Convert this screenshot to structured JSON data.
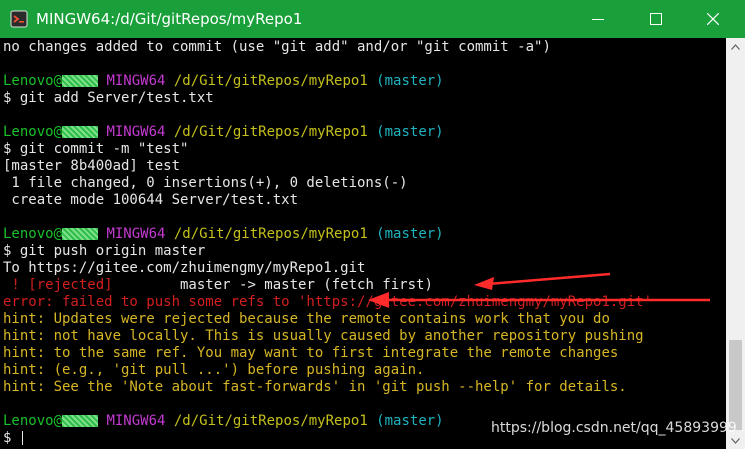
{
  "window": {
    "title": "MINGW64:/d/Git/gitRepos/myRepo1",
    "colors": {
      "titlebar": "#1aa03a",
      "background": "#000000"
    }
  },
  "terminal": {
    "lines": [
      {
        "segments": [
          {
            "text": "no changes added to commit (use \"git add\" and/or \"git commit -a\")",
            "color": "white"
          }
        ]
      },
      {
        "segments": []
      },
      {
        "segments": [
          {
            "text": "Lenovo@",
            "color": "green"
          },
          {
            "redact": true
          },
          {
            "text": " MINGW64",
            "color": "magenta"
          },
          {
            "text": " /d/Git/gitRepos/myRepo1",
            "color": "yellow"
          },
          {
            "text": " (master)",
            "color": "cyan"
          }
        ]
      },
      {
        "segments": [
          {
            "text": "$ git add Server/test.txt",
            "color": "white"
          }
        ]
      },
      {
        "segments": []
      },
      {
        "segments": [
          {
            "text": "Lenovo@",
            "color": "green"
          },
          {
            "redact": true
          },
          {
            "text": " MINGW64",
            "color": "magenta"
          },
          {
            "text": " /d/Git/gitRepos/myRepo1",
            "color": "yellow"
          },
          {
            "text": " (master)",
            "color": "cyan"
          }
        ]
      },
      {
        "segments": [
          {
            "text": "$ git commit -m \"test\"",
            "color": "white"
          }
        ]
      },
      {
        "segments": [
          {
            "text": "[master 8b400ad] test",
            "color": "white"
          }
        ]
      },
      {
        "segments": [
          {
            "text": " 1 file changed, 0 insertions(+), 0 deletions(-)",
            "color": "white"
          }
        ]
      },
      {
        "segments": [
          {
            "text": " create mode 100644 Server/test.txt",
            "color": "white"
          }
        ]
      },
      {
        "segments": []
      },
      {
        "segments": [
          {
            "text": "Lenovo@",
            "color": "green"
          },
          {
            "redact": true
          },
          {
            "text": " MINGW64",
            "color": "magenta"
          },
          {
            "text": " /d/Git/gitRepos/myRepo1",
            "color": "yellow"
          },
          {
            "text": " (master)",
            "color": "cyan"
          }
        ]
      },
      {
        "segments": [
          {
            "text": "$ git push origin master",
            "color": "white"
          }
        ]
      },
      {
        "segments": [
          {
            "text": "To https://gitee.com/zhuimengmy/myRepo1.git",
            "color": "white"
          }
        ]
      },
      {
        "segments": [
          {
            "text": " ! [rejected]",
            "color": "red"
          },
          {
            "text": "        master -> master (fetch first)",
            "color": "white"
          }
        ]
      },
      {
        "segments": [
          {
            "text": "error: failed to push some refs to 'https://gitee.com/zhuimengmy/myRepo1.git'",
            "color": "red"
          }
        ]
      },
      {
        "segments": [
          {
            "text": "hint: Updates were rejected because the remote contains work that you do",
            "color": "hint"
          }
        ]
      },
      {
        "segments": [
          {
            "text": "hint: not have locally. This is usually caused by another repository pushing",
            "color": "hint"
          }
        ]
      },
      {
        "segments": [
          {
            "text": "hint: to the same ref. You may want to first integrate the remote changes",
            "color": "hint"
          }
        ]
      },
      {
        "segments": [
          {
            "text": "hint: (e.g., 'git pull ...') before pushing again.",
            "color": "hint"
          }
        ]
      },
      {
        "segments": [
          {
            "text": "hint: See the 'Note about fast-forwards' in 'git push --help' for details.",
            "color": "hint"
          }
        ]
      },
      {
        "segments": []
      },
      {
        "segments": [
          {
            "text": "Lenovo@",
            "color": "green"
          },
          {
            "redact": true
          },
          {
            "text": " MINGW64",
            "color": "magenta"
          },
          {
            "text": " /d/Git/gitRepos/myRepo1",
            "color": "yellow"
          },
          {
            "text": " (master)",
            "color": "cyan"
          }
        ]
      },
      {
        "segments": [
          {
            "text": "$ ",
            "color": "white"
          }
        ],
        "cursor": true
      }
    ]
  },
  "watermark": "https://blog.csdn.net/qq_45893999",
  "icons": {
    "app": "git-bash-icon",
    "minimize": "minimize-icon",
    "maximize": "maximize-icon",
    "close": "close-icon",
    "annotation": "red-arrow-annotation"
  }
}
